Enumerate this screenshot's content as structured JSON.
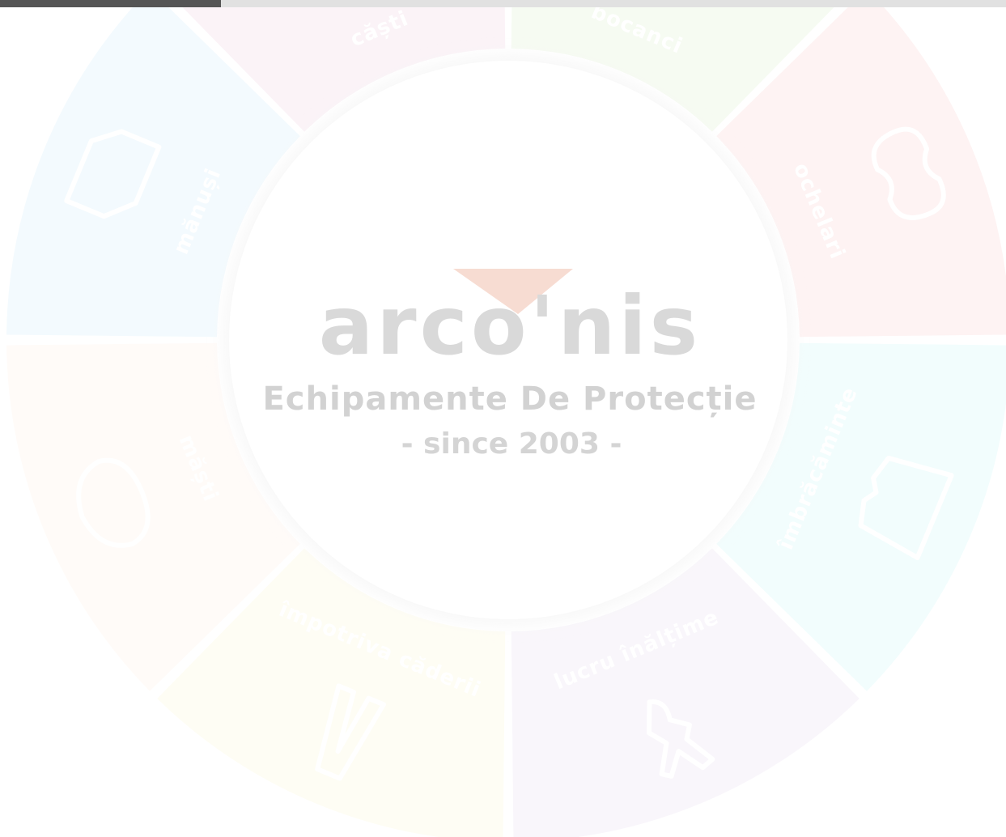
{
  "progress": {
    "fraction": 0.22,
    "fill_color": "#555555",
    "track_color": "#e1e1e1"
  },
  "logo": {
    "brand": "arco'nis",
    "subtitle": "Echipamente De Protecție",
    "since": "- since 2003 -",
    "accent_color": "#f5d4c8",
    "text_color": "#d9d9d9"
  },
  "segments": [
    {
      "id": "casti",
      "label": "căști",
      "icon": "helmet-icon",
      "color": "#fbf3f7"
    },
    {
      "id": "bocanci",
      "label": "bocanci",
      "icon": "boot-icon",
      "color": "#f6fbf2"
    },
    {
      "id": "ochelari",
      "label": "ochelari",
      "icon": "goggles-icon",
      "color": "#fef3f3"
    },
    {
      "id": "imbracaminte",
      "label": "îmbrăcăminte",
      "icon": "clothing-icon",
      "color": "#f2fdfd"
    },
    {
      "id": "lucru-inaltime",
      "label": "lucru înălțime",
      "icon": "harness-icon",
      "color": "#f9f6fb"
    },
    {
      "id": "impotriva-caderii",
      "label": "împotriva căderii",
      "icon": "safety-vest-icon",
      "color": "#fefdf4"
    },
    {
      "id": "masti",
      "label": "măști",
      "icon": "mask-icon",
      "color": "#fffbf8"
    },
    {
      "id": "manusi",
      "label": "mănuși",
      "icon": "glove-icon",
      "color": "#f3fafe"
    }
  ]
}
